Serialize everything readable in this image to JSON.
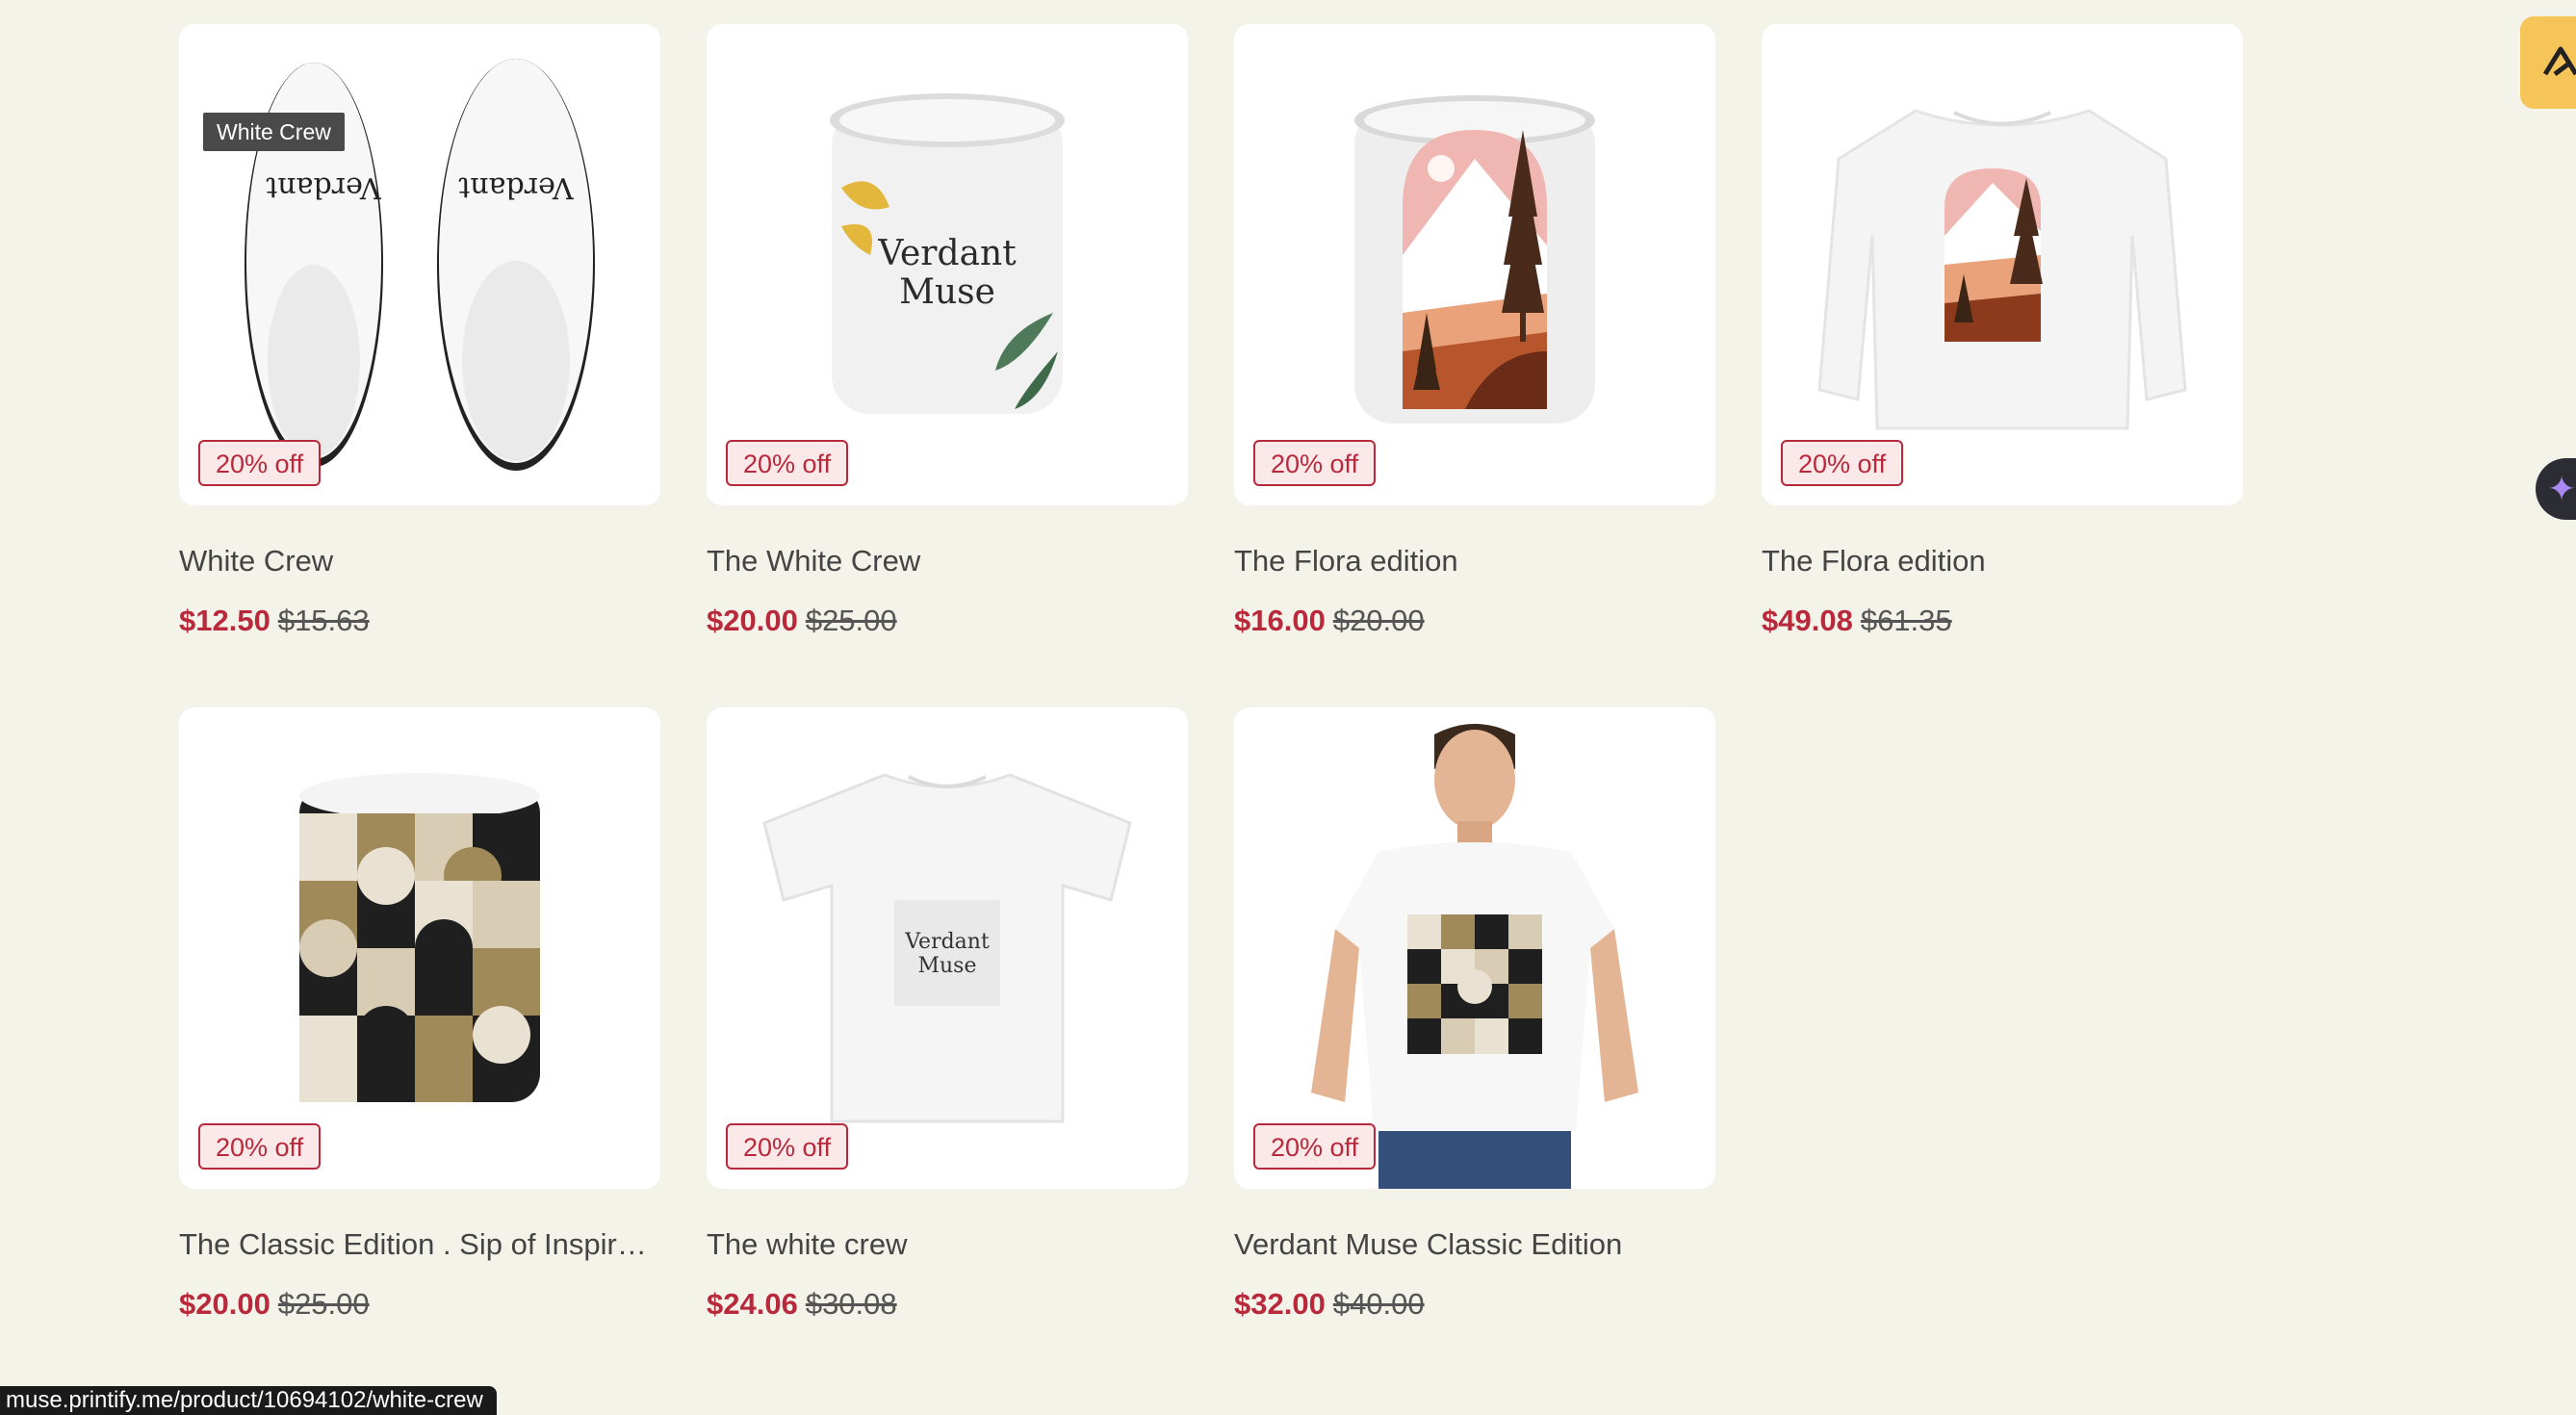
{
  "tooltip": "White Crew",
  "discount_label": "20% off",
  "products": [
    {
      "title": "White Crew",
      "price": "$12.50",
      "compare_price": "$15.63",
      "image": "white-slippers"
    },
    {
      "title": "The White Crew",
      "price": "$20.00",
      "compare_price": "$25.00",
      "image": "verdant-muse-mug"
    },
    {
      "title": "The Flora edition",
      "price": "$16.00",
      "compare_price": "$20.00",
      "image": "flora-mug"
    },
    {
      "title": "The Flora edition",
      "price": "$49.08",
      "compare_price": "$61.35",
      "image": "flora-sweatshirt"
    },
    {
      "title": "The Classic Edition . Sip of Inspiration",
      "price": "$20.00",
      "compare_price": "$25.00",
      "image": "geometric-mug"
    },
    {
      "title": "The white crew",
      "price": "$24.06",
      "compare_price": "$30.08",
      "image": "white-tshirt"
    },
    {
      "title": "Verdant Muse Classic Edition",
      "price": "$32.00",
      "compare_price": "$40.00",
      "image": "model-tshirt"
    }
  ],
  "artwork_text": {
    "brand_line1": "Verdant",
    "brand_line2": "Muse"
  },
  "status_bar_url": "muse.printify.me/product/10694102/white-crew",
  "colors": {
    "background": "#f4f3ea",
    "sale_red": "#b8293b",
    "badge_bg": "#fbe9e9",
    "side_tab": "#f6c55a"
  },
  "icons": {
    "side_tab": "logo-icon",
    "side_pill": "sparkle-icon"
  }
}
